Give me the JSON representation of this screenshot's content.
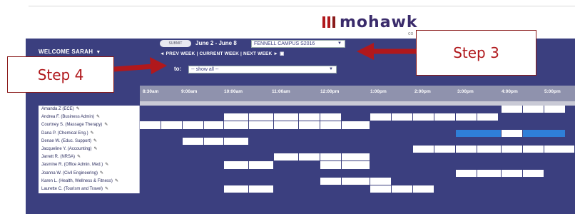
{
  "logo": {
    "word": "mohawk",
    "sub": "co"
  },
  "header": {
    "welcome": "WELCOME SARAH",
    "toggle_label": "SUBMIT",
    "week_label": "June 2 - June 8",
    "campus_value": "FENNELL CAMPUS S2016",
    "week_nav": "◄ PREV WEEK | CURRENT WEEK | NEXT WEEK ► ▣",
    "filter_label": "to:",
    "filter_value": "-- show all --"
  },
  "time_columns": [
    "8:30am",
    "9:00am",
    "10:00am",
    "11:00am",
    "12:00pm",
    "1:00pm",
    "2:00pm",
    "3:00pm",
    "4:00pm",
    "5:00pm"
  ],
  "rows": [
    {
      "name": "Amanda Z (ECE)",
      "slots": [
        [
          507,
          30,
          "white"
        ],
        [
          537,
          30,
          "white"
        ],
        [
          567,
          30,
          "white"
        ]
      ]
    },
    {
      "name": "Andrea F. (Business Admin)",
      "slots": [
        [
          118,
          35,
          "white"
        ],
        [
          153,
          35,
          "white"
        ],
        [
          188,
          35,
          "white"
        ],
        [
          223,
          30,
          "white"
        ],
        [
          253,
          30,
          "white"
        ],
        [
          323,
          30,
          "white"
        ],
        [
          353,
          30,
          "white"
        ],
        [
          383,
          30,
          "white"
        ],
        [
          413,
          30,
          "white"
        ],
        [
          443,
          30,
          "white"
        ],
        [
          473,
          30,
          "white"
        ]
      ]
    },
    {
      "name": "Courtney S. (Massage Therapy)",
      "slots": [
        [
          0,
          30,
          "white"
        ],
        [
          30,
          30,
          "white"
        ],
        [
          60,
          30,
          "white"
        ],
        [
          90,
          28,
          "white"
        ],
        [
          118,
          35,
          "white"
        ],
        [
          153,
          35,
          "white"
        ],
        [
          188,
          35,
          "white"
        ],
        [
          223,
          30,
          "white"
        ],
        [
          253,
          30,
          "white"
        ],
        [
          283,
          40,
          "white"
        ]
      ]
    },
    {
      "name": "Dana P. (Chemical Eng.)",
      "slots": [
        [
          443,
          64,
          "blue"
        ],
        [
          507,
          30,
          "white"
        ],
        [
          537,
          60,
          "blue"
        ]
      ]
    },
    {
      "name": "Denae W. (Educ. Support)",
      "slots": [
        [
          60,
          30,
          "white"
        ],
        [
          90,
          28,
          "white"
        ],
        [
          118,
          35,
          "white"
        ]
      ]
    },
    {
      "name": "Jacqueline Y. (Accounting)",
      "slots": [
        [
          383,
          30,
          "white"
        ],
        [
          413,
          30,
          "white"
        ],
        [
          443,
          30,
          "white"
        ],
        [
          473,
          34,
          "white"
        ],
        [
          507,
          30,
          "white"
        ],
        [
          537,
          30,
          "white"
        ],
        [
          567,
          43,
          "white"
        ]
      ]
    },
    {
      "name": "Jarrett R. (NRSA)",
      "slots": [
        [
          188,
          35,
          "white"
        ],
        [
          223,
          30,
          "white"
        ],
        [
          253,
          30,
          "white"
        ],
        [
          283,
          40,
          "white"
        ]
      ]
    },
    {
      "name": "Jasmine R. (Office Admin. Med.)",
      "slots": [
        [
          118,
          35,
          "white"
        ],
        [
          153,
          35,
          "white"
        ],
        [
          253,
          30,
          "white"
        ],
        [
          283,
          40,
          "white"
        ]
      ]
    },
    {
      "name": "Joanna W. (Civil Engineering)",
      "slots": [
        [
          443,
          30,
          "white"
        ],
        [
          473,
          34,
          "white"
        ],
        [
          507,
          30,
          "white"
        ],
        [
          537,
          30,
          "white"
        ]
      ]
    },
    {
      "name": "Karen L. (Health, Wellness & Fitness)",
      "slots": [
        [
          253,
          30,
          "white"
        ],
        [
          283,
          40,
          "white"
        ],
        [
          323,
          30,
          "white"
        ]
      ]
    },
    {
      "name": "Laurette C. (Tourism and Travel)",
      "slots": [
        [
          118,
          35,
          "white"
        ],
        [
          153,
          35,
          "white"
        ],
        [
          323,
          30,
          "white"
        ],
        [
          353,
          30,
          "white"
        ],
        [
          383,
          30,
          "white"
        ]
      ]
    }
  ],
  "callouts": {
    "step3": "Step 3",
    "step4": "Step 4"
  },
  "colors": {
    "brand": "#3b3f7f",
    "accent": "#b0181c",
    "booked": "#2f7fd8"
  }
}
